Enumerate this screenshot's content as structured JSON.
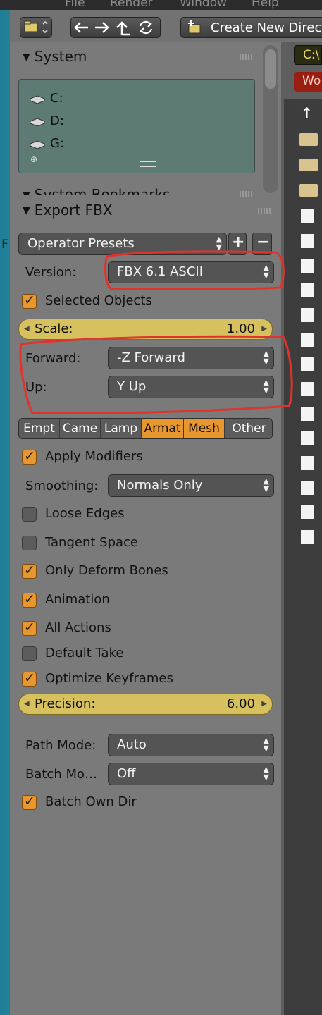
{
  "menubar": {
    "items": [
      "File",
      "Render",
      "Window",
      "Help"
    ]
  },
  "toolbar": {
    "nav_icons": [
      "back-arrow-icon",
      "forward-arrow-icon",
      "parent-directory-icon",
      "refresh-icon"
    ],
    "create_dir_label": "Create New Direct"
  },
  "system": {
    "title": "System",
    "drives": [
      "C:",
      "D:",
      "G:"
    ]
  },
  "bookmarks": {
    "title": "System Bookmarks"
  },
  "export": {
    "title": "Export FBX",
    "operator_presets": "Operator Presets",
    "version_label": "Version:",
    "version_value": "FBX 6.1 ASCII",
    "selected_objects": {
      "label": "Selected Objects",
      "checked": true
    },
    "scale": {
      "label": "Scale:",
      "value": "1.00"
    },
    "forward_label": "Forward:",
    "forward_value": "-Z Forward",
    "up_label": "Up:",
    "up_value": "Y Up",
    "object_types": [
      {
        "label": "Empt",
        "selected": false
      },
      {
        "label": "Came",
        "selected": false
      },
      {
        "label": "Lamp",
        "selected": false
      },
      {
        "label": "Armat",
        "selected": true
      },
      {
        "label": "Mesh",
        "selected": true
      },
      {
        "label": "Other",
        "selected": false
      }
    ],
    "apply_modifiers": {
      "label": "Apply Modifiers",
      "checked": true
    },
    "smoothing_label": "Smoothing:",
    "smoothing_value": "Normals Only",
    "loose_edges": {
      "label": "Loose Edges",
      "checked": false
    },
    "tangent_space": {
      "label": "Tangent Space",
      "checked": false
    },
    "only_deform_bones": {
      "label": "Only Deform Bones",
      "checked": true
    },
    "animation": {
      "label": "Animation",
      "checked": true
    },
    "all_actions": {
      "label": "All Actions",
      "checked": true
    },
    "default_take": {
      "label": "Default Take",
      "checked": false
    },
    "optimize_keyframes": {
      "label": "Optimize Keyframes",
      "checked": true
    },
    "precision": {
      "label": "Precision:",
      "value": "6.00"
    },
    "path_mode_label": "Path Mode:",
    "path_mode_value": "Auto",
    "batch_mode_label": "Batch Mo…",
    "batch_mode_value": "Off",
    "batch_own_dir": {
      "label": "Batch Own Dir",
      "checked": true
    }
  },
  "file_browser": {
    "path": "C:\\",
    "tag": "Wo",
    "parent_symbol": "↑"
  },
  "left_strip": {
    "letter": "F"
  },
  "colors": {
    "accent": "#e8962e",
    "slider": "#d7c15e",
    "panel": "#7a7a7a",
    "annotation": "#e0332d"
  }
}
